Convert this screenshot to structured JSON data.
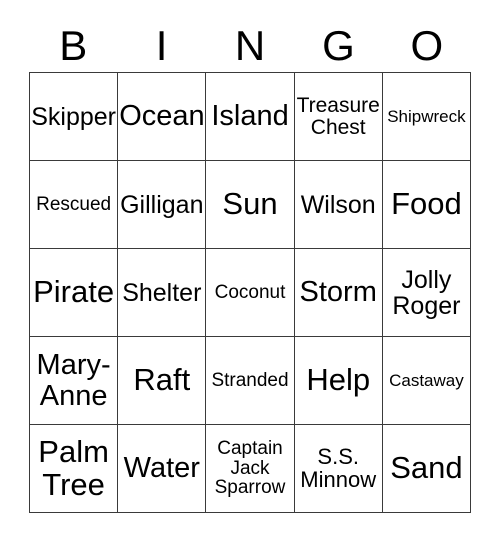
{
  "header": {
    "letters": [
      "B",
      "I",
      "N",
      "G",
      "O"
    ]
  },
  "grid": {
    "columns": 5,
    "rows": 5,
    "cells": [
      [
        {
          "text": "Skipper",
          "size": "fs-md"
        },
        {
          "text": "Ocean",
          "size": "fs-lg"
        },
        {
          "text": "Island",
          "size": "fs-lg"
        },
        {
          "text": "Treasure\nChest",
          "size": "fs-xs"
        },
        {
          "text": "Shipwreck",
          "size": "fs-tiny"
        }
      ],
      [
        {
          "text": "Rescued",
          "size": "fs-xxs"
        },
        {
          "text": "Gilligan",
          "size": "fs-md"
        },
        {
          "text": "Sun",
          "size": "fs-xl"
        },
        {
          "text": "Wilson",
          "size": "fs-md"
        },
        {
          "text": "Food",
          "size": "fs-xl"
        }
      ],
      [
        {
          "text": "Pirate",
          "size": "fs-xl"
        },
        {
          "text": "Shelter",
          "size": "fs-md"
        },
        {
          "text": "Coconut",
          "size": "fs-xxs"
        },
        {
          "text": "Storm",
          "size": "fs-lg"
        },
        {
          "text": "Jolly\nRoger",
          "size": "fs-md"
        }
      ],
      [
        {
          "text": "Mary-\nAnne",
          "size": "fs-lg"
        },
        {
          "text": "Raft",
          "size": "fs-xl"
        },
        {
          "text": "Stranded",
          "size": "fs-xxs"
        },
        {
          "text": "Help",
          "size": "fs-xl"
        },
        {
          "text": "Castaway",
          "size": "fs-tiny"
        }
      ],
      [
        {
          "text": "Palm\nTree",
          "size": "fs-xl"
        },
        {
          "text": "Water",
          "size": "fs-lg"
        },
        {
          "text": "Captain\nJack\nSparrow",
          "size": "fs-xxs"
        },
        {
          "text": "S.S.\nMinnow",
          "size": "fs-sm"
        },
        {
          "text": "Sand",
          "size": "fs-xl"
        }
      ]
    ]
  },
  "colors": {
    "grid_line": "#3a3a3a",
    "text": "#000000",
    "background": "#ffffff"
  }
}
